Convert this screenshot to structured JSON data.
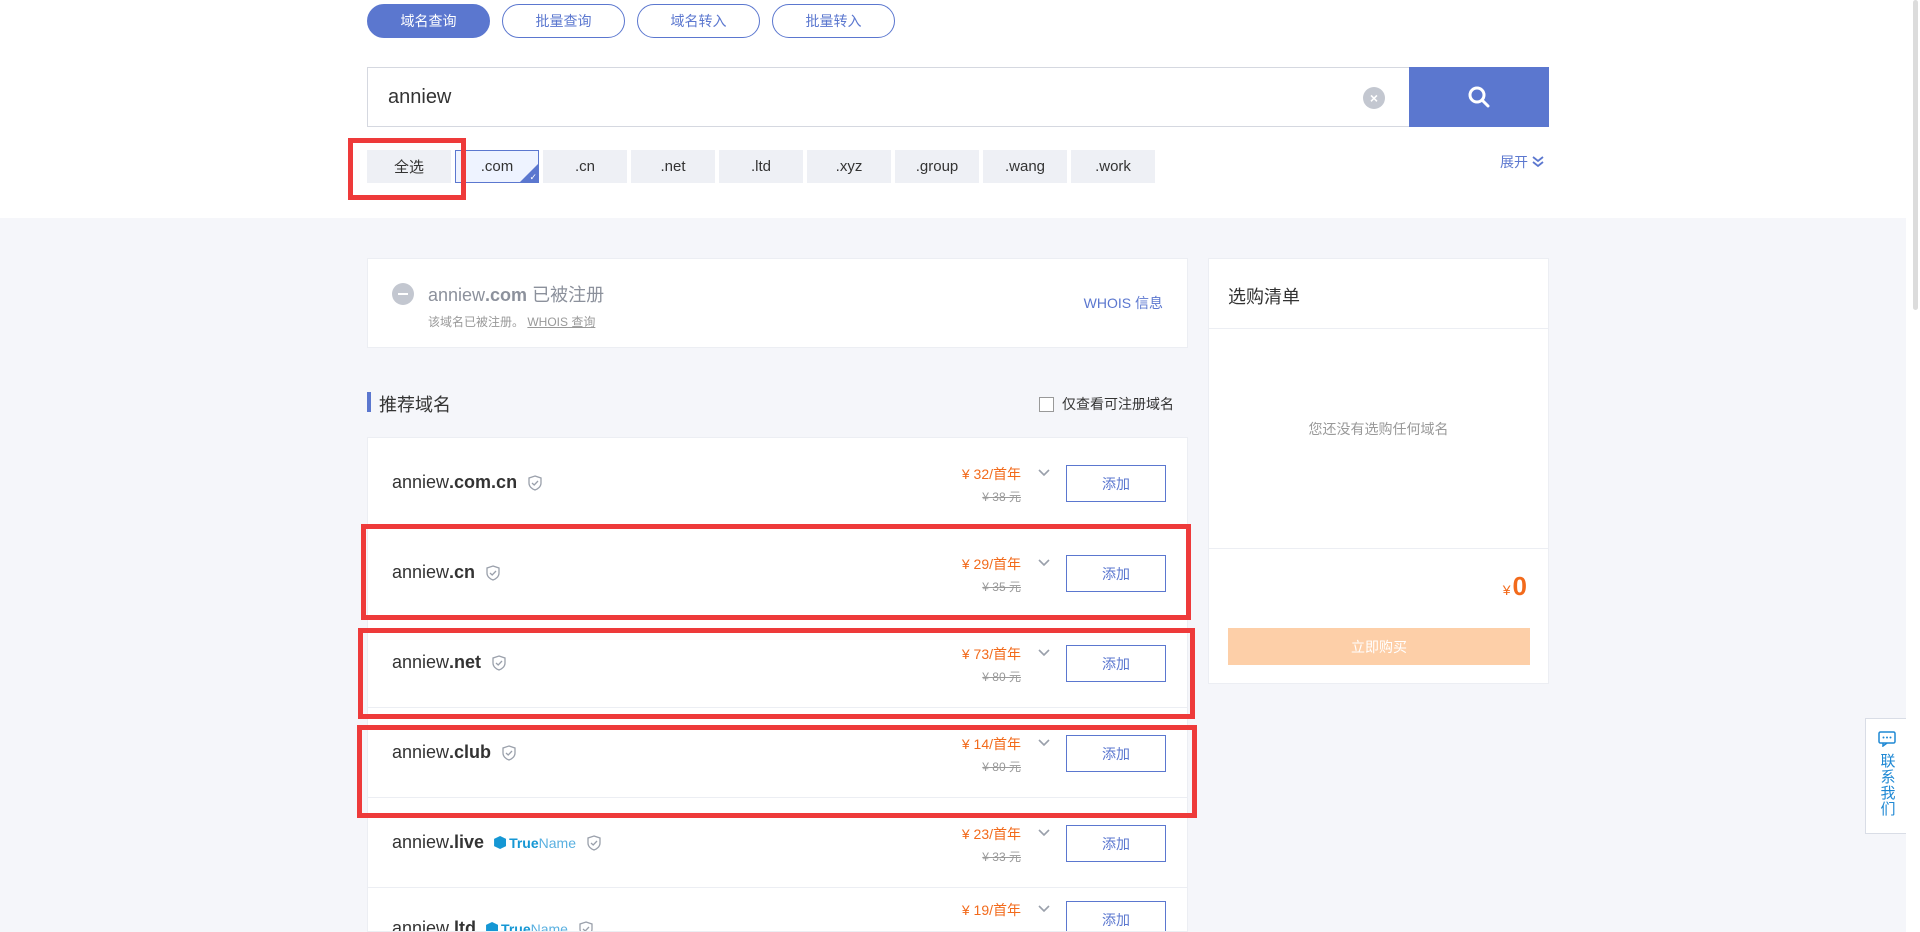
{
  "tabs": [
    {
      "label": "域名查询",
      "active": true
    },
    {
      "label": "批量查询",
      "active": false
    },
    {
      "label": "域名转入",
      "active": false
    },
    {
      "label": "批量转入",
      "active": false
    }
  ],
  "search": {
    "value": "anniew",
    "placeholder": ""
  },
  "suffixes": {
    "select_all": "全选",
    "items": [
      ".com",
      ".cn",
      ".net",
      ".ltd",
      ".xyz",
      ".group",
      ".wang",
      ".work"
    ],
    "selected": ".com",
    "expand_label": "展开"
  },
  "registered": {
    "name": "anniew",
    "suffix": ".com",
    "status": "已被注册",
    "note": "该域名已被注册。",
    "whois_query": "WHOIS 查询",
    "whois_info": "WHOIS 信息"
  },
  "recommend": {
    "title": "推荐域名",
    "only_available": "仅查看可注册域名",
    "add_label": "添加",
    "rows": [
      {
        "name": "anniew",
        "suffix": ".com.cn",
        "price": "¥ 32/首年",
        "old": "¥ 38 元",
        "truename": false
      },
      {
        "name": "anniew",
        "suffix": ".cn",
        "price": "¥ 29/首年",
        "old": "¥ 35 元",
        "truename": false
      },
      {
        "name": "anniew",
        "suffix": ".net",
        "price": "¥ 73/首年",
        "old": "¥ 80 元",
        "truename": false
      },
      {
        "name": "anniew",
        "suffix": ".club",
        "price": "¥ 14/首年",
        "old": "¥ 80 元",
        "truename": false
      },
      {
        "name": "anniew",
        "suffix": ".live",
        "price": "¥ 23/首年",
        "old": "¥ 33 元",
        "truename": true
      },
      {
        "name": "anniew",
        "suffix": ".ltd",
        "price": "¥ 19/首年",
        "old": "",
        "truename": true
      }
    ],
    "truename_a": "True",
    "truename_b": "Name"
  },
  "cart": {
    "title": "选购清单",
    "empty": "您还没有选购任何域名",
    "currency": "¥",
    "total": "0",
    "buy_label": "立即购买"
  },
  "contact": {
    "label": "联系我们"
  },
  "colors": {
    "accent": "#5b77cf",
    "price": "#f26a1b",
    "highlight": "#ee3a3a"
  }
}
